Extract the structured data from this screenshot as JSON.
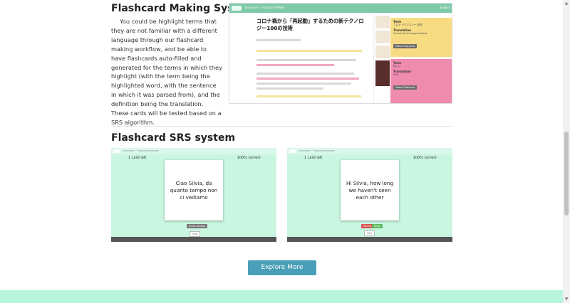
{
  "sections": {
    "flashcard_making": {
      "title": "Flashcard Making System",
      "description": "You could be highlight terms that they are not familiar with a different language through our flashcard making workflow, and be able to have flashcards auto-filled and generated for the terms in which they highlight (with the term being the highlighted word, with the sentence in which it was parsed from), and the definition being the translation. These cards will be tested based on a SRS algorithm."
    },
    "flashcard_srs": {
      "title": "Flashcard SRS system"
    }
  },
  "screenshot1": {
    "brand": "Lexiconer · Flashcard Maker",
    "nav_right": "English",
    "article_title": "コロナ禍から「再起動」するための新テクノロジー100の技術",
    "panel_yellow": {
      "term_label": "Term",
      "term_value": "コロナ テクノロジー 新技",
      "translation_label": "Translation",
      "translation_value": "Corona Technology Newest",
      "button": "Make Flashcard"
    },
    "panel_pink": {
      "term_label": "Term",
      "term_value": "新しい",
      "translation_label": "Translation",
      "translation_value": "New",
      "button": "Make Flashcard"
    }
  },
  "srs_left": {
    "brand": "Lexiconer · Flashcard Review",
    "cards_left": "1 card left",
    "correct": "100% correct",
    "card_text": "Ciao Silvia, da quanto tempo non ci vediamo",
    "show_button": "Show Answer",
    "small_button": "Skip"
  },
  "srs_right": {
    "brand": "Lexiconer · Flashcard Review",
    "cards_left": "1 card left",
    "correct": "100% correct",
    "card_text": "Hi Silvia, how long we haven't seen each other",
    "wrong_button": "Wrong",
    "right_button": "Right",
    "small_button": "Skip"
  },
  "explore_button": "Explore More",
  "colors": {
    "accent": "#4a9fb8",
    "mint": "#c9f6e1",
    "yellow_panel": "#f7dc83",
    "pink_panel": "#f08bb0"
  }
}
